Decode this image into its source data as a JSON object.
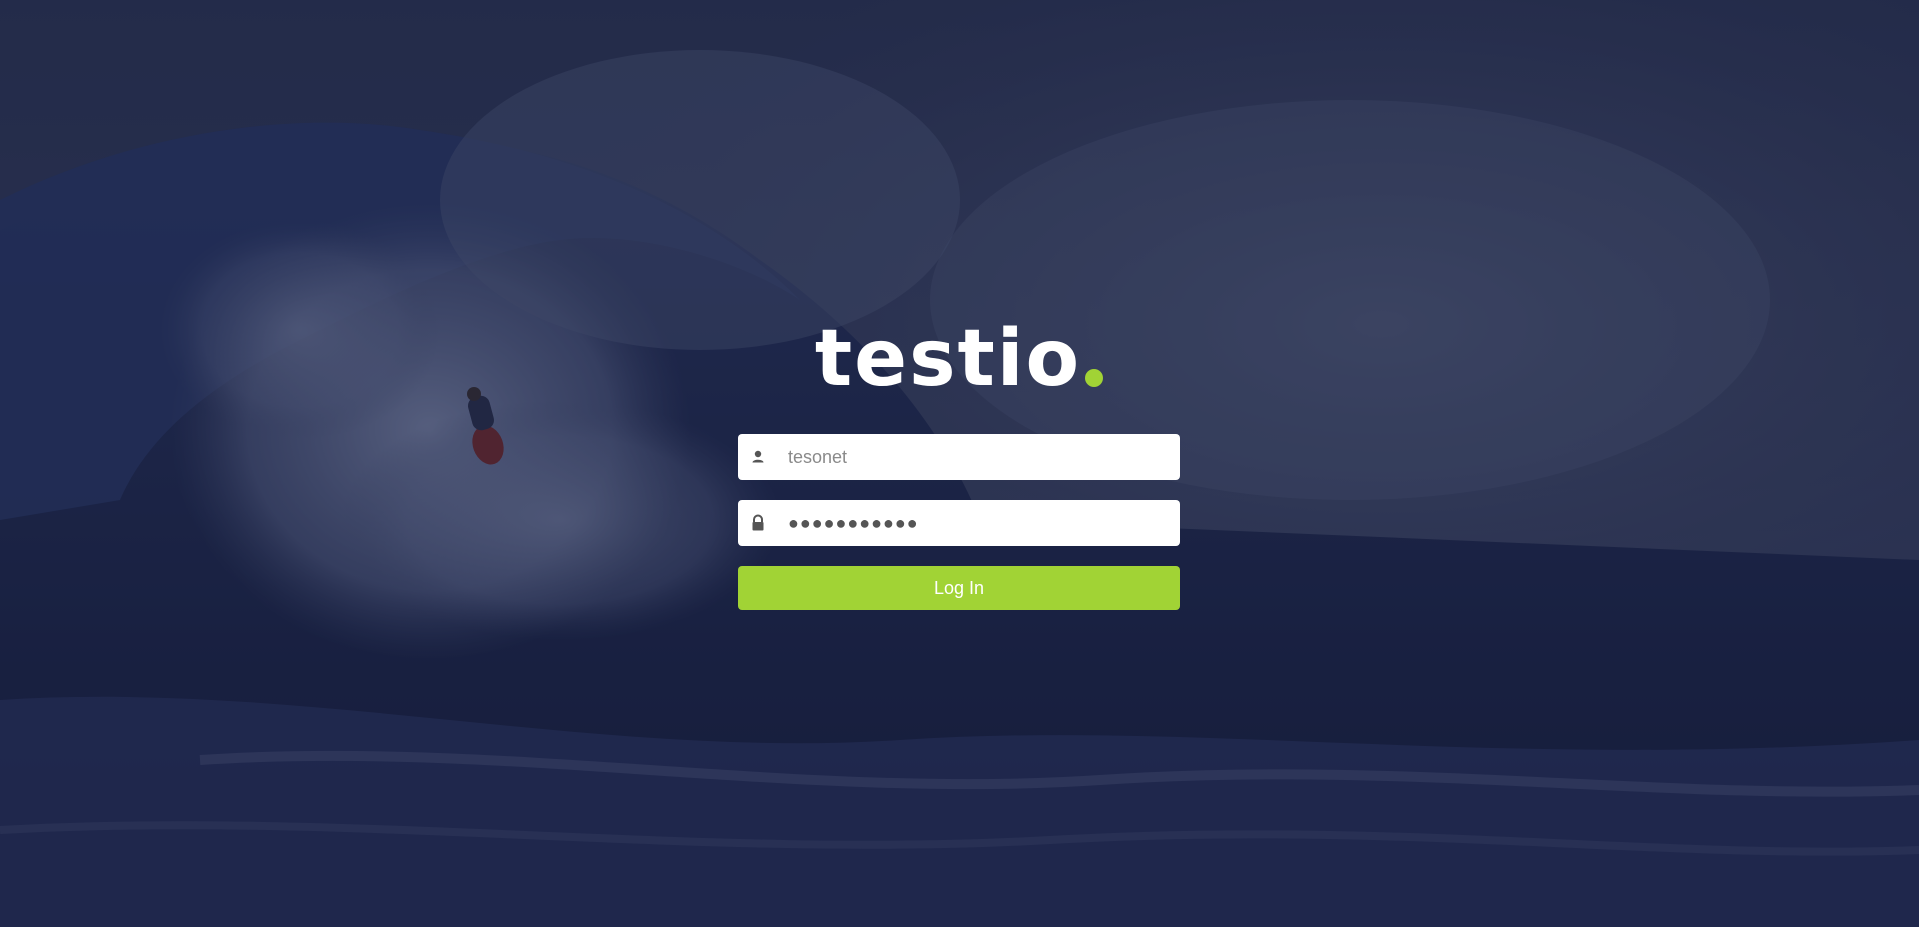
{
  "brand": {
    "name": "testio",
    "accent_color": "#a1d335"
  },
  "login_form": {
    "username": {
      "placeholder": "tesonet",
      "icon": "user-icon"
    },
    "password": {
      "value": "●●●●●●●●●●●",
      "icon": "lock-icon"
    },
    "submit_label": "Log In"
  },
  "colors": {
    "overlay": "#1c2447",
    "button": "#a1d335"
  }
}
